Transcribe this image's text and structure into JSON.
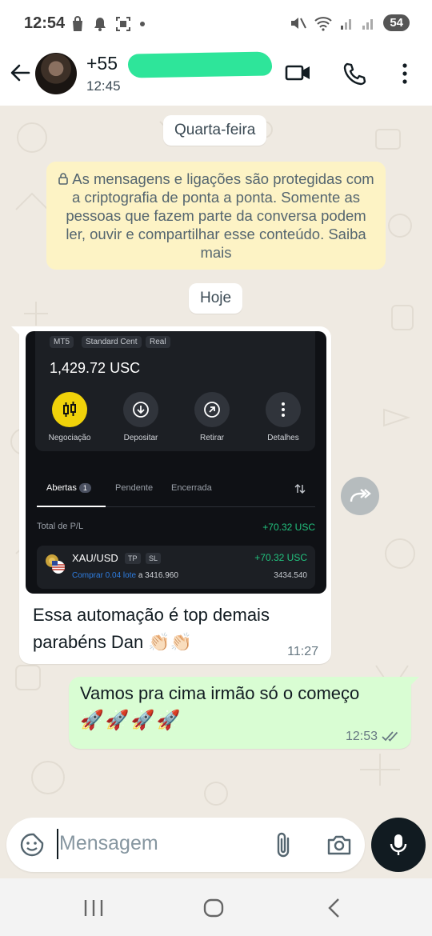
{
  "status_bar": {
    "time": "12:54",
    "battery": "54"
  },
  "header": {
    "name": "+55",
    "status": "12:45"
  },
  "chat": {
    "date_chip_1": "Quarta-feira",
    "encryption_notice": "As mensagens e ligações são protegidas com a criptografia de ponta a ponta. Somente as pessoas que fazem parte da conversa podem ler, ouvir e compartilhar esse conteúdo. Saiba mais",
    "date_chip_2": "Hoje",
    "incoming": {
      "screenshot": {
        "pills": [
          "MT5",
          "Standard Cent",
          "Real"
        ],
        "balance": "1,429.72 USC",
        "actions": [
          "Negociação",
          "Depositar",
          "Retirar",
          "Detalhes"
        ],
        "tabs": [
          "Abertas",
          "Pendente",
          "Encerrada"
        ],
        "open_count": "1",
        "pl_label": "Total de P/L",
        "pl_value": "+70.32 USC",
        "position": {
          "symbol": "XAU/USD",
          "tags": [
            "TP",
            "SL"
          ],
          "buy_text": "Comprar 0.04 lote",
          "buy_price": "a 3416.960",
          "pl": "+70.32 USC",
          "current": "3434.540"
        }
      },
      "text": "Essa automação é top demais parabéns Dan 👏🏻👏🏻",
      "time": "11:27"
    },
    "outgoing": {
      "text": "Vamos pra cima irmão só o começo",
      "emojis": "🚀🚀🚀🚀",
      "time": "12:53"
    }
  },
  "input": {
    "placeholder": "Mensagem"
  },
  "colors": {
    "accent_green": "#d9fdd3",
    "redaction": "#2ee59a",
    "yellow_action": "#f0d20a"
  }
}
